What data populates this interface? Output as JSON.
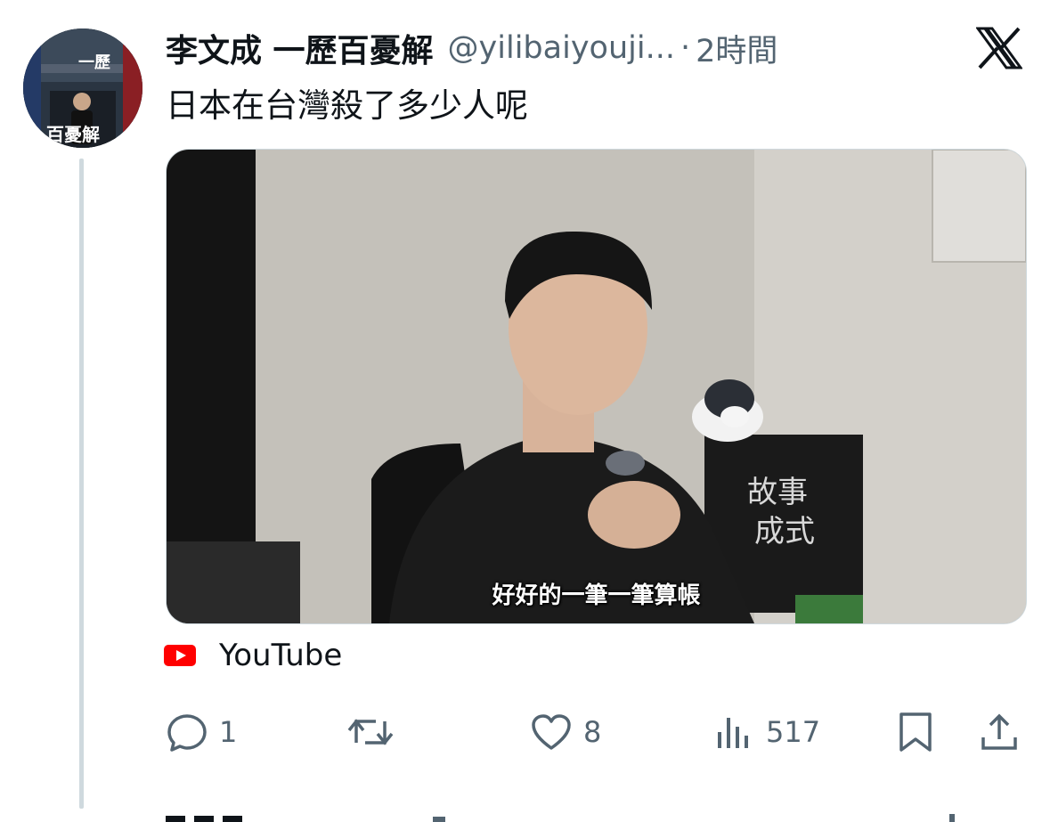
{
  "tweet": {
    "author_name": "李文成 一歷百憂解",
    "handle": "@yilibaiyouji...",
    "separator": "·",
    "time": "2時間",
    "text": "日本在台灣殺了多少人呢"
  },
  "avatar": {
    "text_top": "一歷",
    "text_bottom": "百憂解"
  },
  "media": {
    "subtitle": "好好的一筆一筆算帳",
    "box_text_line1": "故事",
    "box_text_line2": "成式"
  },
  "source": {
    "label": "YouTube",
    "icon": "youtube-play-icon",
    "color": "#ff0000"
  },
  "actions": {
    "reply_count": "1",
    "retweet_count": "",
    "like_count": "8",
    "views_count": "517"
  },
  "colors": {
    "text": "#0f1419",
    "secondary": "#536471",
    "thread_line": "#cfd9de"
  }
}
